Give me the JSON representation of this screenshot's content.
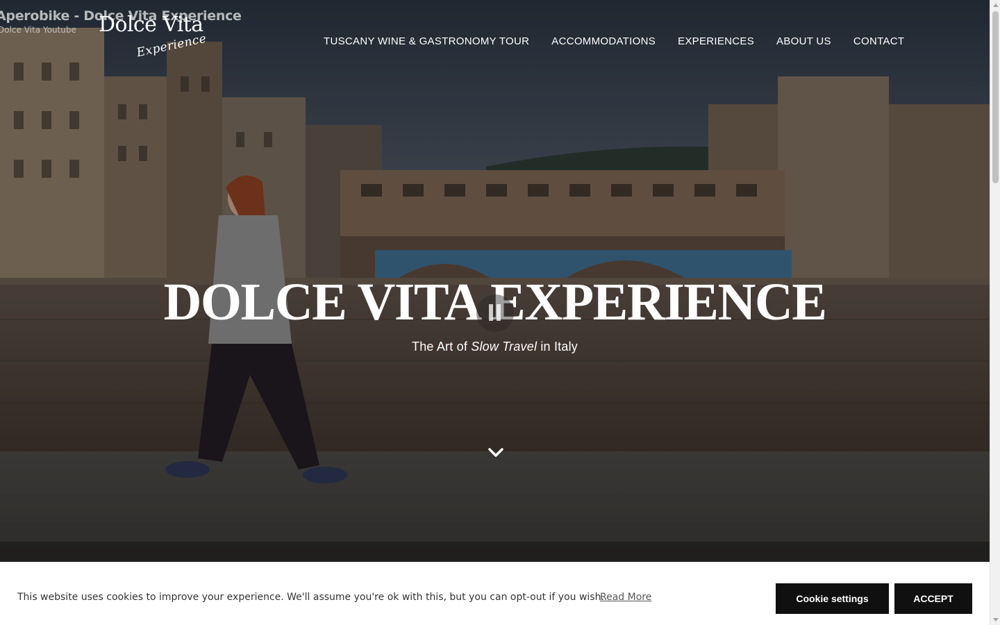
{
  "video_overlay": {
    "title": "Aperobike - Dolce Vita Experience",
    "channel": "Dolce Vita Youtube"
  },
  "logo": {
    "main": "Dolce Vita",
    "sub": "Experience"
  },
  "nav": {
    "items": [
      {
        "label": "TUSCANY WINE & GASTRONOMY TOUR"
      },
      {
        "label": "ACCOMMODATIONS"
      },
      {
        "label": "EXPERIENCES"
      },
      {
        "label": "ABOUT US"
      },
      {
        "label": "CONTACT"
      }
    ]
  },
  "hero": {
    "title": "DOLCE VITA EXPERIENCE",
    "subtitle_before": "The Art of ",
    "subtitle_emphasis": "Slow Travel",
    "subtitle_after": " in Italy",
    "scroll_icon": "chevron-down-icon",
    "video_control_icon": "pause-icon"
  },
  "cookie": {
    "message": "This website uses cookies to improve your experience. We'll assume you're ok with this, but you can opt-out if you wish.",
    "read_more": "Read More",
    "settings_label": "Cookie settings",
    "accept_label": "ACCEPT"
  },
  "colors": {
    "nav_text": "#ffffff",
    "cookie_bar_bg": "#ffffff",
    "button_bg": "#101010",
    "button_text": "#ffffff"
  }
}
